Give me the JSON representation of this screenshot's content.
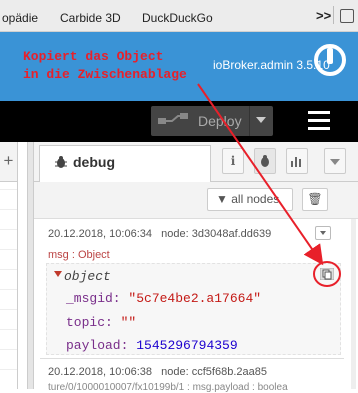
{
  "bookmarks": {
    "items": [
      "opädie",
      "Carbide 3D",
      "DuckDuckGo"
    ],
    "more": ">>"
  },
  "header": {
    "annotation_lines": [
      "Kopiert das Object",
      "in die Zwischenablage"
    ],
    "title": "ioBroker.admin 3.5.10",
    "accent_color": "#3a93d6",
    "annotation_color": "#e8202a"
  },
  "toolbar": {
    "deploy_label": "Deploy",
    "menu_icon": "hamburger-icon"
  },
  "workspace": {
    "add_tab": "+"
  },
  "sidebar": {
    "tab_label": "debug",
    "tab_icon": "bug-icon",
    "tab_buttons": [
      "info-icon",
      "bug-icon",
      "chart-icon",
      "chevron-down-icon"
    ],
    "filter_label": "all nodes",
    "clear_icon": "trash-icon"
  },
  "message": {
    "timestamp": "20.12.2018, 10:06:34",
    "node": "node: 3d3048af.dd639",
    "topic_line": "msg : Object",
    "object_label": "object",
    "fields": [
      {
        "key": "_msgid:",
        "value": "\"5c7e4be2.a17664\"",
        "kind": "string"
      },
      {
        "key": "topic:",
        "value": "\"\"",
        "kind": "string"
      },
      {
        "key": "payload:",
        "value": "1545296794359",
        "kind": "number"
      }
    ]
  },
  "message2": {
    "timestamp": "20.12.2018, 10:06:38",
    "node": "node: ccf5f68b.2aa85",
    "partial": "ture/0/1000010007/fx10199b/1 : msg.payload : boolea"
  }
}
